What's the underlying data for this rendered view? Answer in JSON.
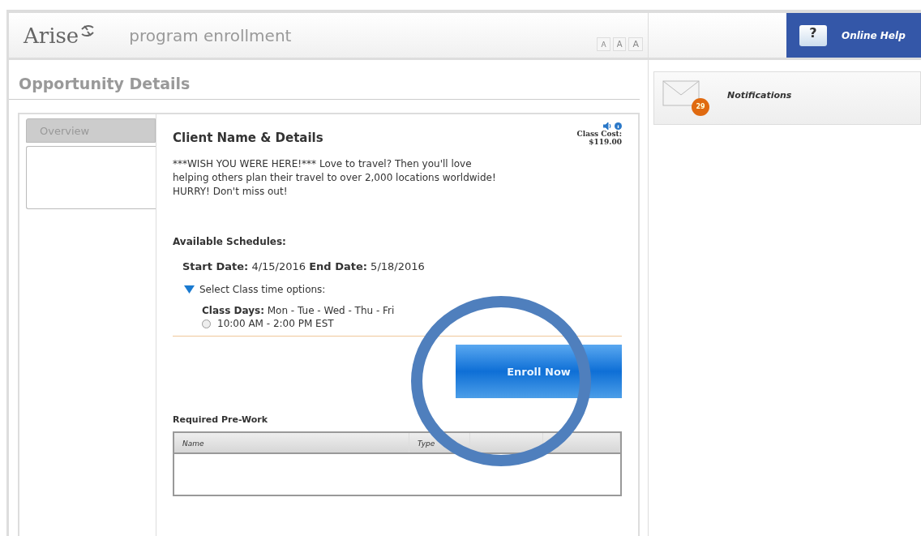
{
  "header": {
    "logo": "Arise",
    "title": "program enrollment",
    "font_sizes": [
      "A",
      "A",
      "A"
    ]
  },
  "help": {
    "label": "Online Help",
    "icon_text": "?"
  },
  "notifications": {
    "label": "Notifications",
    "count": "29"
  },
  "page_title": "Opportunity Details",
  "tabs": [
    {
      "label": "Overview",
      "selected": false
    }
  ],
  "card": {
    "title": "Client Name & Details",
    "cost_label": "Class Cost:",
    "cost": "$119.00",
    "description": "***WISH YOU WERE HERE!*** Love to travel? Then you'll love helping others plan their travel to over 2,000 locations worldwide! HURRY! Don't miss out!",
    "schedules_heading": "Available Schedules:",
    "dates": "**Start Date:** 4/15/2016 **End Date:** 5/18/2016",
    "options_label": "Select Class time options:",
    "options_expanded": true,
    "class_days": "**Class Days:** Mon - Tue - Wed - Thu - Fri",
    "times": [
      {
        "label": "10:00 AM - 2:00 PM EST",
        "selected": false
      }
    ],
    "enroll_button": "Enroll Now"
  },
  "prework": {
    "heading": "Required Pre-Work",
    "columns": [
      "Name",
      "Type"
    ]
  }
}
